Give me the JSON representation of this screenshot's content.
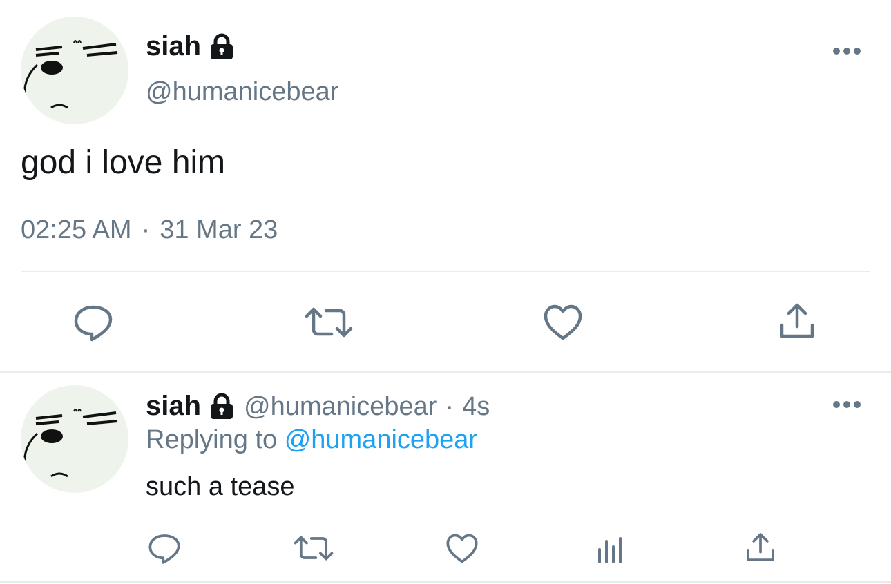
{
  "main_tweet": {
    "display_name": "siah",
    "handle": "@humanicebear",
    "text": "god i love him",
    "time": "02:25 AM",
    "separator": "·",
    "date": "31 Mar 23",
    "icons": {
      "protected": "lock-icon",
      "more": "more-icon",
      "reply": "reply-icon",
      "retweet": "retweet-icon",
      "like": "heart-icon",
      "share": "share-icon"
    }
  },
  "reply_tweet": {
    "display_name": "siah",
    "handle": "@humanicebear",
    "separator": "·",
    "age": "4s",
    "replying_prefix": "Replying to",
    "replying_to": "@humanicebear",
    "text": "such a tease",
    "icons": {
      "protected": "lock-icon",
      "more": "more-icon",
      "reply": "reply-icon",
      "retweet": "retweet-icon",
      "like": "heart-icon",
      "analytics": "analytics-icon",
      "share": "share-icon"
    }
  },
  "colors": {
    "text": "#14171a",
    "secondary": "#657786",
    "link": "#1da1f2",
    "divider": "#e6ecf0",
    "avatar_bg": "#eef3ec"
  }
}
